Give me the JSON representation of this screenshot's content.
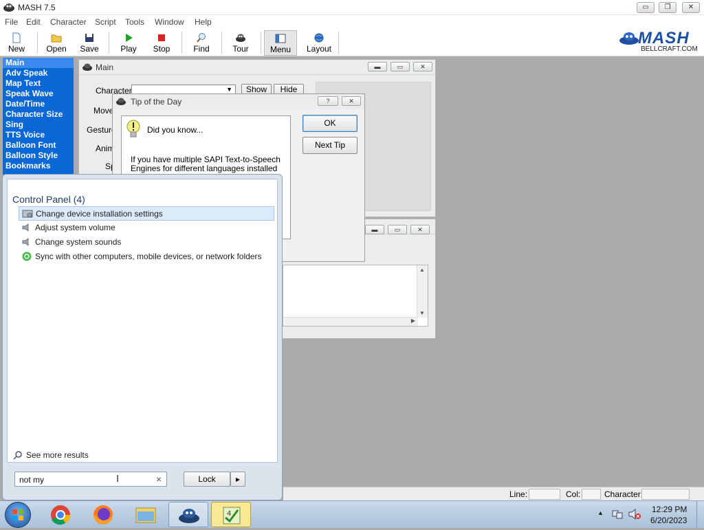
{
  "app": {
    "title": "MASH 7.5",
    "brand_text": "MASH",
    "brand_sub": "BELLCRAFT.COM"
  },
  "window_buttons": {
    "minimize": "▭",
    "restore": "❐",
    "close": "✕"
  },
  "menu": [
    "File",
    "Edit",
    "Character",
    "Script",
    "Tools",
    "Window",
    "Help"
  ],
  "toolbar": [
    {
      "label": "New",
      "icon": "new-doc-icon"
    },
    {
      "label": "Open",
      "icon": "open-folder-icon"
    },
    {
      "label": "Save",
      "icon": "save-disk-icon"
    },
    {
      "label": "Play",
      "icon": "play-icon"
    },
    {
      "label": "Stop",
      "icon": "stop-icon"
    },
    {
      "label": "Find",
      "icon": "find-icon"
    },
    {
      "label": "Tour",
      "icon": "tour-icon"
    },
    {
      "label": "Menu",
      "icon": "menu-icon"
    },
    {
      "label": "Layout",
      "icon": "layout-icon"
    }
  ],
  "sidebar": {
    "items": [
      "Main",
      "Adv Speak",
      "Map Text",
      "Speak Wave",
      "Date/Time",
      "Character Size",
      "Sing",
      "TTS Voice",
      "Balloon Font",
      "Balloon Style",
      "Bookmarks"
    ],
    "selected": "Main"
  },
  "main_window": {
    "title": "Main",
    "labels": {
      "character": "Character",
      "move": "Move",
      "gesture": "Gesture",
      "anim": "Anim",
      "sp": "Sp"
    },
    "show": "Show",
    "hide": "Hide"
  },
  "tip_dialog": {
    "title": "Tip of the Day",
    "help_btn": "?",
    "close_btn": "✕",
    "heading": "Did you know...",
    "text": "If you have multiple SAPI Text-to-Speech Engines for different languages installed on",
    "ok": "OK",
    "next_tip": "Next Tip"
  },
  "start_menu": {
    "group_title": "Control Panel (4)",
    "results": [
      {
        "label": "Change device installation settings",
        "icon": "device-settings-icon"
      },
      {
        "label": "Adjust system volume",
        "icon": "speaker-icon"
      },
      {
        "label": "Change system sounds",
        "icon": "speaker-icon"
      },
      {
        "label": "Sync with other computers, mobile devices, or network folders",
        "icon": "sync-icon"
      }
    ],
    "see_more": "See more results",
    "search_value": "not my",
    "clear": "×",
    "lock": "Lock",
    "lock_arrow": "▸"
  },
  "status_bar": {
    "line": "Line:",
    "col": "Col:",
    "character": "Character:"
  },
  "taskbar": {
    "time": "12:29 PM",
    "date": "6/20/2023",
    "items": [
      "start-orb",
      "chrome",
      "firefox",
      "explorer",
      "mash",
      "agent"
    ]
  }
}
